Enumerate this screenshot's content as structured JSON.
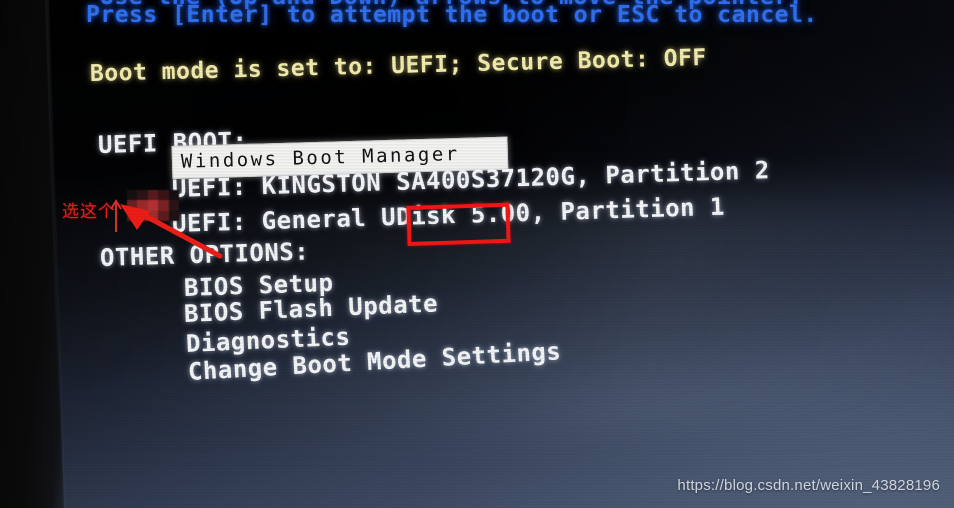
{
  "screen": {
    "type": "bios-boot-menu",
    "top_clipped_line": "Use the (Up and Down) arrows to move the pointer.",
    "prompt_line": "Press [Enter] to attempt the boot or ESC to cancel.",
    "boot_mode_line": "Boot mode is set to: UEFI; Secure Boot: OFF",
    "sections": [
      {
        "heading": "UEFI BOOT:",
        "items": [
          {
            "label": "Windows Boot Manager",
            "selected": true
          },
          {
            "label": "UEFI: KINGSTON SA400S37120G, Partition 2",
            "selected": false
          },
          {
            "label": "UEFI: General UDisk 5.00, Partition 1",
            "selected": false
          }
        ]
      },
      {
        "heading": "OTHER OPTIONS:",
        "items": [
          {
            "label": "BIOS Setup",
            "selected": false
          },
          {
            "label": "BIOS Flash Update",
            "selected": false
          },
          {
            "label": "Diagnostics",
            "selected": false
          },
          {
            "label": "Change Boot Mode Settings",
            "selected": false
          }
        ]
      }
    ]
  },
  "annotations": {
    "chinese_note": "选这个",
    "highlight_word": "UDisk",
    "arrow": "red-arrow-pointing-up-left",
    "redaction": "mosaic-block"
  },
  "watermark": {
    "text": "https://blog.csdn.net/weixin_43828196"
  },
  "colors": {
    "prompt_blue": "#2f6ff0",
    "boot_mode_yellow": "#f2ecae",
    "menu_white": "#f4f5f7",
    "selection_bg": "#f3f3f1",
    "selection_fg": "#131313",
    "annotation_red": "#e8201b",
    "highlight_box_red": "#f21717"
  }
}
